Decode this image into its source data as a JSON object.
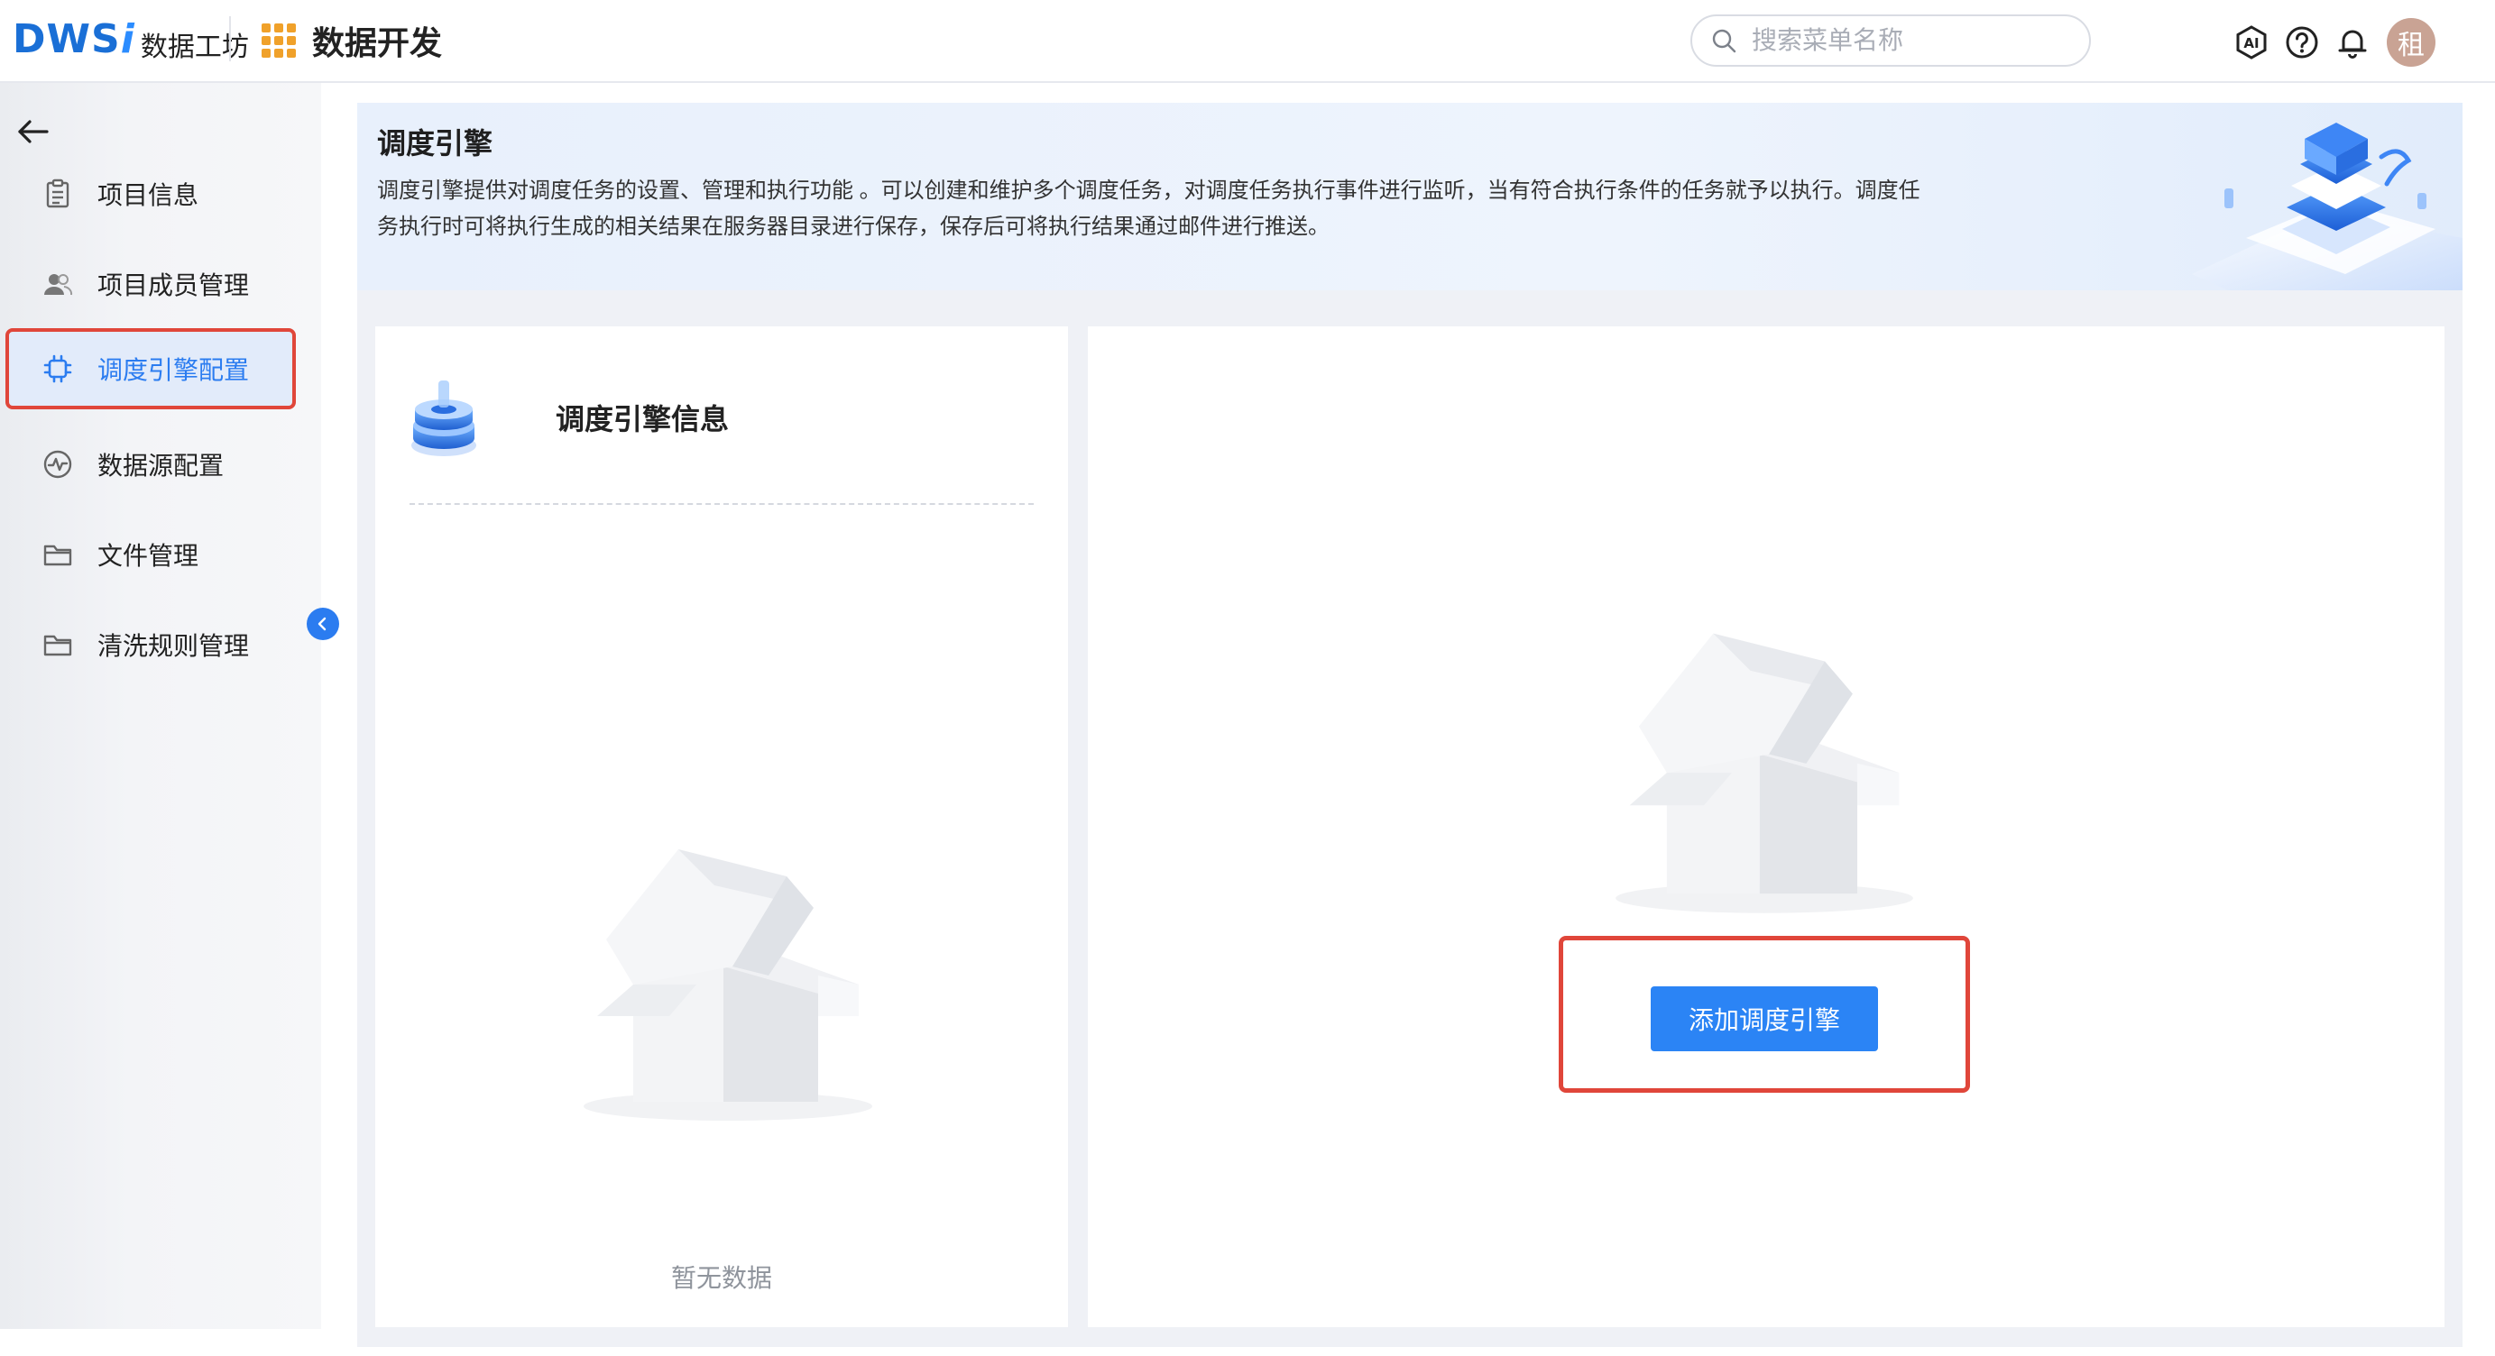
{
  "brand": {
    "logo": "DWS",
    "logo_i": "i",
    "name": "数据工坊"
  },
  "module": {
    "title": "数据开发"
  },
  "search": {
    "placeholder": "搜索菜单名称"
  },
  "user": {
    "avatar_text": "租"
  },
  "sidebar": {
    "items": [
      {
        "label": "项目信息",
        "icon": "clipboard-icon"
      },
      {
        "label": "项目成员管理",
        "icon": "users-icon"
      },
      {
        "label": "调度引擎配置",
        "icon": "chip-icon",
        "active": true
      },
      {
        "label": "数据源配置",
        "icon": "pulse-icon"
      },
      {
        "label": "文件管理",
        "icon": "folder-icon"
      },
      {
        "label": "清洗规则管理",
        "icon": "folder-icon"
      }
    ]
  },
  "banner": {
    "title": "调度引擎",
    "description": "调度引擎提供对调度任务的设置、管理和执行功能 。可以创建和维护多个调度任务，对调度任务执行事件进行监听，当有符合执行条件的任务就予以执行。调度任务执行时可将执行生成的相关结果在服务器目录进行保存，保存后可将执行结果通过邮件进行推送。"
  },
  "engine_info": {
    "title": "调度引擎信息",
    "empty_text": "暂无数据"
  },
  "actions": {
    "add_engine": "添加调度引擎"
  },
  "colors": {
    "accent": "#2b84f5",
    "highlight": "#e0463a",
    "grid_icon": "#f0a12a"
  }
}
